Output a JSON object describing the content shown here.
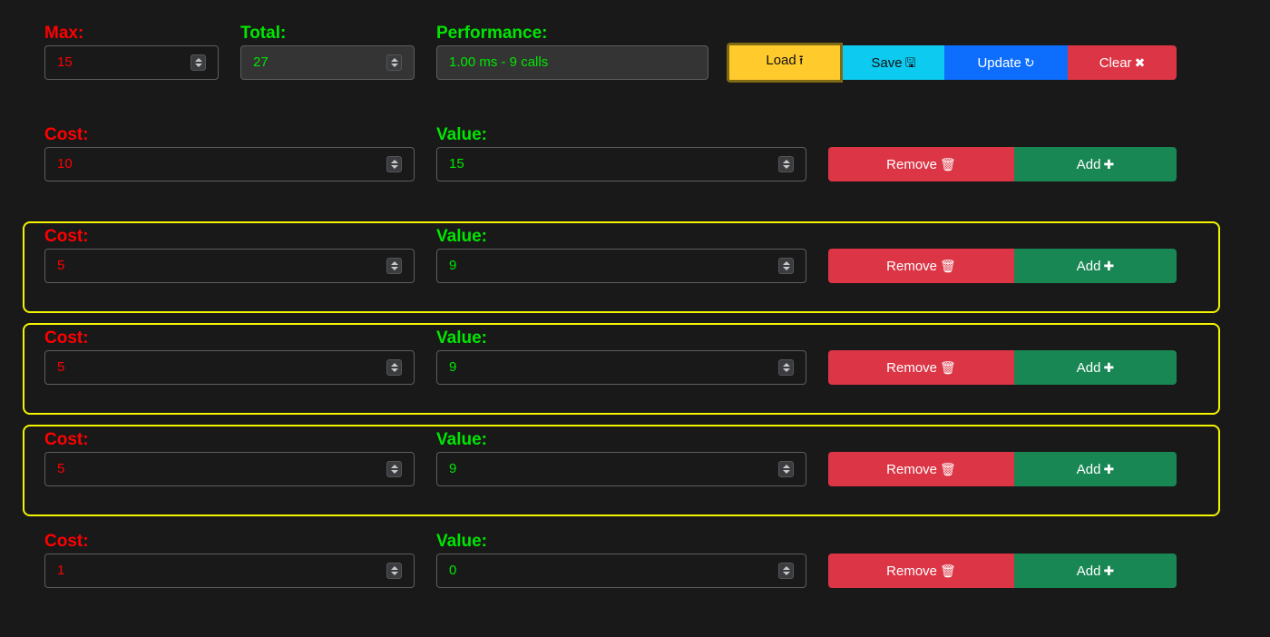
{
  "header": {
    "max_label": "Max:",
    "max_value": "15",
    "total_label": "Total:",
    "total_value": "27",
    "performance_label": "Performance:",
    "performance_value": "1.00 ms - 9 calls",
    "buttons": {
      "load": "Load",
      "save": "Save",
      "update": "Update",
      "clear": "Clear"
    }
  },
  "items": [
    {
      "cost_label": "Cost:",
      "cost": "10",
      "value_label": "Value:",
      "value": "15",
      "remove": "Remove",
      "add": "Add",
      "selected": false
    },
    {
      "cost_label": "Cost:",
      "cost": "5",
      "value_label": "Value:",
      "value": "9",
      "remove": "Remove",
      "add": "Add",
      "selected": true
    },
    {
      "cost_label": "Cost:",
      "cost": "5",
      "value_label": "Value:",
      "value": "9",
      "remove": "Remove",
      "add": "Add",
      "selected": true
    },
    {
      "cost_label": "Cost:",
      "cost": "5",
      "value_label": "Value:",
      "value": "9",
      "remove": "Remove",
      "add": "Add",
      "selected": true
    },
    {
      "cost_label": "Cost:",
      "cost": "1",
      "value_label": "Value:",
      "value": "0",
      "remove": "Remove",
      "add": "Add",
      "selected": false
    }
  ],
  "icons": {
    "load": "upload-icon",
    "save": "floppy-disk-icon",
    "update": "refresh-icon",
    "clear": "x-icon",
    "remove": "trash-icon",
    "add": "plus-icon"
  },
  "colors": {
    "cost": "#ff0000",
    "value": "#00e600",
    "highlight": "#f4f400"
  }
}
